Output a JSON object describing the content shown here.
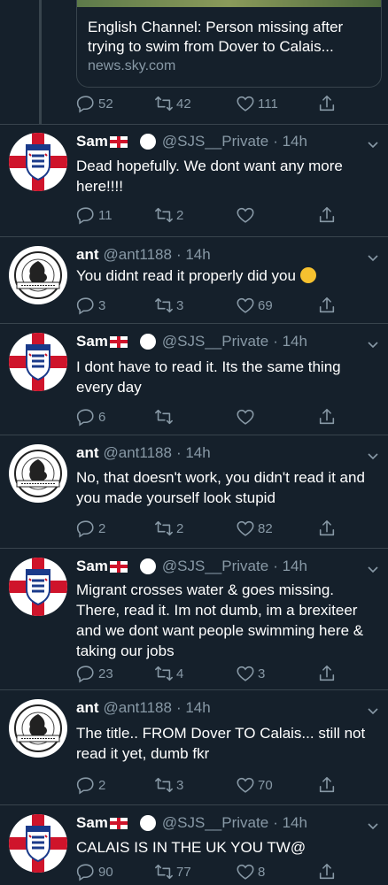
{
  "link_card": {
    "title": "English Channel: Person missing after trying to swim from Dover to Calais...",
    "domain": "news.sky.com"
  },
  "top_actions": {
    "replies": "52",
    "retweets": "42",
    "likes": "111"
  },
  "tweets": [
    {
      "name": "Sam",
      "handle": "@SJS__Private",
      "time": "· 14h",
      "text": "Dead hopefully. We dont want any more here!!!!",
      "replies": "11",
      "retweets": "2",
      "likes": ""
    },
    {
      "name": "ant",
      "handle": "@ant1188",
      "time": "· 14h",
      "text": "You didnt read it properly did you",
      "replies": "3",
      "retweets": "3",
      "likes": "69"
    },
    {
      "name": "Sam",
      "handle": "@SJS__Private",
      "time": "· 14h",
      "text": "I dont have to read it. Its the same thing every day",
      "replies": "6",
      "retweets": "",
      "likes": ""
    },
    {
      "name": "ant",
      "handle": "@ant1188",
      "time": "· 14h",
      "text": "No, that doesn't work, you didn't read it and you made yourself look stupid",
      "replies": "2",
      "retweets": "2",
      "likes": "82"
    },
    {
      "name": "Sam",
      "handle": "@SJS__Private",
      "time": "· 14h",
      "text": "Migrant crosses water & goes missing. There, read it. Im not dumb, im a brexiteer and we dont want people swimming here & taking our jobs",
      "replies": "23",
      "retweets": "4",
      "likes": "3"
    },
    {
      "name": "ant",
      "handle": "@ant1188",
      "time": "· 14h",
      "text": "The title.. FROM Dover TO Calais... still not read it yet, dumb fkr",
      "replies": "2",
      "retweets": "3",
      "likes": "70"
    },
    {
      "name": "Sam",
      "handle": "@SJS__Private",
      "time": "· 14h",
      "text": "CALAIS IS IN THE UK YOU TW@",
      "replies": "90",
      "retweets": "77",
      "likes": "8"
    }
  ],
  "avatars": {
    "england_label": "ENGLAND",
    "club_motto": "ARTE ET LABORE"
  },
  "colors": {
    "background": "#15202b",
    "secondary_text": "#8899a6",
    "divider": "#38444d",
    "flag_red": "#cf142b"
  }
}
